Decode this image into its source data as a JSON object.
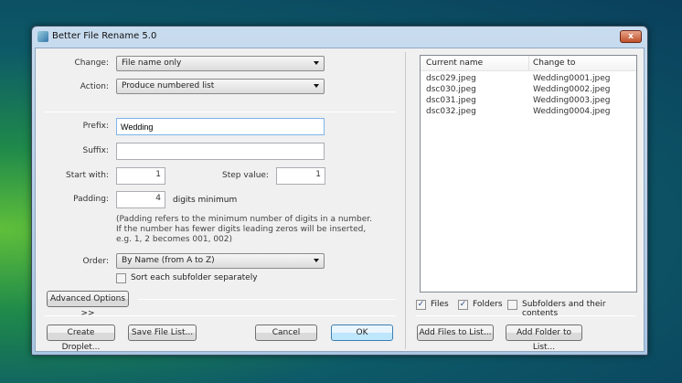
{
  "window": {
    "title": "Better File Rename 5.0",
    "close_label": "x"
  },
  "form": {
    "change_label": "Change:",
    "change_value": "File name only",
    "action_label": "Action:",
    "action_value": "Produce numbered list",
    "prefix_label": "Prefix:",
    "prefix_value": "Wedding",
    "suffix_label": "Suffix:",
    "suffix_value": "",
    "start_label": "Start with:",
    "start_value": "1",
    "step_label": "Step value:",
    "step_value": "1",
    "padding_label": "Padding:",
    "padding_value": "4",
    "padding_suffix": "digits minimum",
    "padding_note": [
      "(Padding refers to the minimum number of digits in a number.",
      "If the number has fewer digits leading zeros will be inserted,",
      "e.g. 1, 2 becomes 001, 002)"
    ],
    "order_label": "Order:",
    "order_value": "By Name (from A to Z)",
    "sort_subfolder_label": "Sort each subfolder separately",
    "sort_subfolder_checked": false,
    "advanced_label": "Advanced Options >>"
  },
  "buttons": {
    "create_droplet": "Create Droplet...",
    "save_file_list": "Save File List...",
    "cancel": "Cancel",
    "ok": "OK",
    "add_files": "Add Files to List...",
    "add_folder": "Add Folder to List..."
  },
  "list": {
    "columns": [
      "Current name",
      "Change to"
    ],
    "rows": [
      [
        "dsc029.jpeg",
        "Wedding0001.jpeg"
      ],
      [
        "dsc030.jpeg",
        "Wedding0002.jpeg"
      ],
      [
        "dsc031.jpeg",
        "Wedding0003.jpeg"
      ],
      [
        "dsc032.jpeg",
        "Wedding0004.jpeg"
      ]
    ]
  },
  "filters": {
    "files_label": "Files",
    "files_checked": true,
    "folders_label": "Folders",
    "folders_checked": true,
    "subfolders_label": "Subfolders and their contents",
    "subfolders_checked": false
  }
}
